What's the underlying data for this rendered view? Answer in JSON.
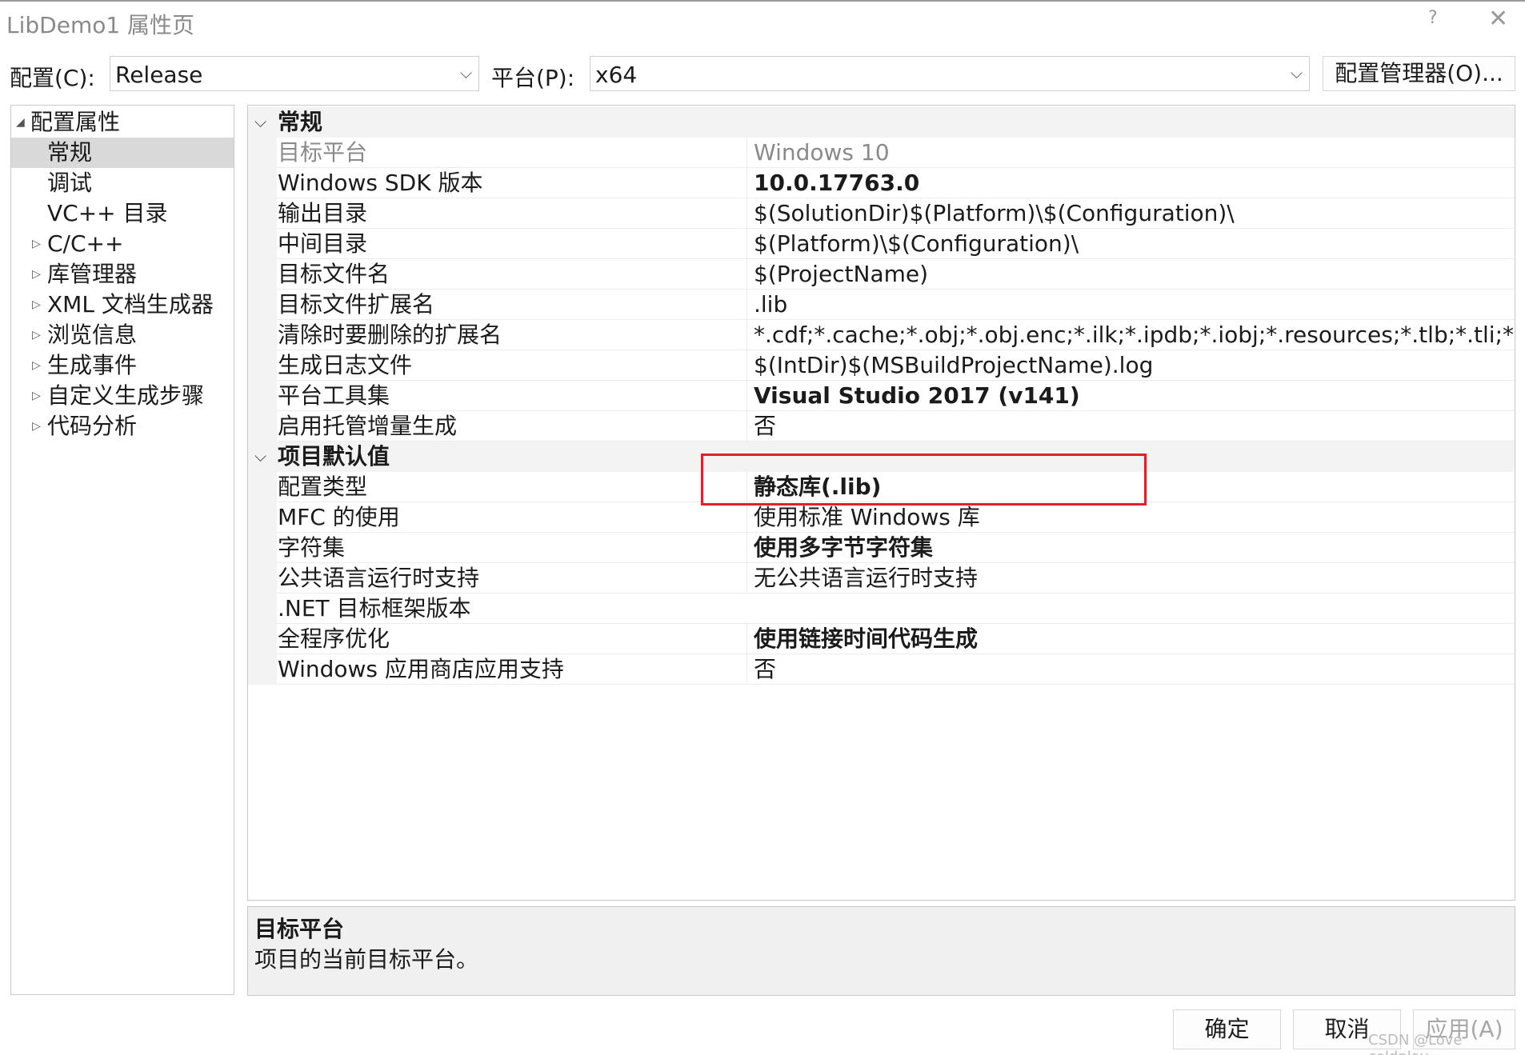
{
  "window": {
    "title": "LibDemo1 属性页",
    "help": "?",
    "close": "✕"
  },
  "config_bar": {
    "config_label": "配置(C):",
    "config_value": "Release",
    "platform_label": "平台(P):",
    "platform_value": "x64",
    "manager_button": "配置管理器(O)..."
  },
  "tree": {
    "root": "配置属性",
    "items": [
      "常规",
      "调试",
      "VC++ 目录",
      "C/C++",
      "库管理器",
      "XML 文档生成器",
      "浏览信息",
      "生成事件",
      "自定义生成步骤",
      "代码分析"
    ]
  },
  "grid": {
    "cat_general": "常规",
    "rows_general": [
      {
        "name": "目标平台",
        "value": "Windows 10"
      },
      {
        "name": "Windows SDK 版本",
        "value": "10.0.17763.0"
      },
      {
        "name": "输出目录",
        "value": "$(SolutionDir)$(Platform)\\$(Configuration)\\"
      },
      {
        "name": "中间目录",
        "value": "$(Platform)\\$(Configuration)\\"
      },
      {
        "name": "目标文件名",
        "value": "$(ProjectName)"
      },
      {
        "name": "目标文件扩展名",
        "value": ".lib"
      },
      {
        "name": "清除时要删除的扩展名",
        "value": "*.cdf;*.cache;*.obj;*.obj.enc;*.ilk;*.ipdb;*.iobj;*.resources;*.tlb;*.tli;*.tlh;*.tmp;"
      },
      {
        "name": "生成日志文件",
        "value": "$(IntDir)$(MSBuildProjectName).log"
      },
      {
        "name": "平台工具集",
        "value": "Visual Studio 2017 (v141)"
      },
      {
        "name": "启用托管增量生成",
        "value": "否"
      }
    ],
    "cat_defaults": "项目默认值",
    "rows_defaults": [
      {
        "name": "配置类型",
        "value": "静态库(.lib)"
      },
      {
        "name": "MFC 的使用",
        "value": "使用标准 Windows 库"
      },
      {
        "name": "字符集",
        "value": "使用多字节字符集"
      },
      {
        "name": "公共语言运行时支持",
        "value": "无公共语言运行时支持"
      },
      {
        "name": ".NET 目标框架版本",
        "value": ""
      },
      {
        "name": "全程序优化",
        "value": "使用链接时间代码生成"
      },
      {
        "name": "Windows 应用商店应用支持",
        "value": "否"
      }
    ]
  },
  "description": {
    "title": "目标平台",
    "text": "项目的当前目标平台。"
  },
  "footer": {
    "ok": "确定",
    "cancel": "取消",
    "apply": "应用(A)"
  },
  "watermark": "CSDN @Love coldplay"
}
